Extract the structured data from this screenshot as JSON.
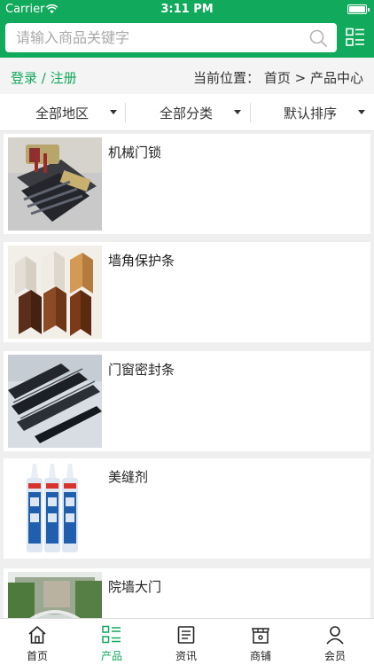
{
  "status_bar": {
    "carrier": "Carrier",
    "time": "3:11 PM"
  },
  "search": {
    "placeholder": "请输入商品关键字",
    "icon": "search-icon"
  },
  "header": {
    "menu_icon": "list-menu-icon",
    "accent": "#11a95b"
  },
  "auth": {
    "login": "登录",
    "separator": "/",
    "register": "注册"
  },
  "breadcrumb": {
    "label": "当前位置：",
    "home": "首页",
    "arrow": ">",
    "current": "产品中心"
  },
  "filters": [
    {
      "label": "全部地区"
    },
    {
      "label": "全部分类"
    },
    {
      "label": "默认排序"
    }
  ],
  "products": [
    {
      "name": "机械门锁"
    },
    {
      "name": "墙角保护条"
    },
    {
      "name": "门窗密封条"
    },
    {
      "name": "美缝剂"
    },
    {
      "name": "院墙大门"
    }
  ],
  "tabs": [
    {
      "label": "首页",
      "icon": "home-icon"
    },
    {
      "label": "产品",
      "icon": "product-list-icon",
      "active": true
    },
    {
      "label": "资讯",
      "icon": "news-icon"
    },
    {
      "label": "商铺",
      "icon": "shop-icon"
    },
    {
      "label": "会员",
      "icon": "member-icon"
    }
  ]
}
